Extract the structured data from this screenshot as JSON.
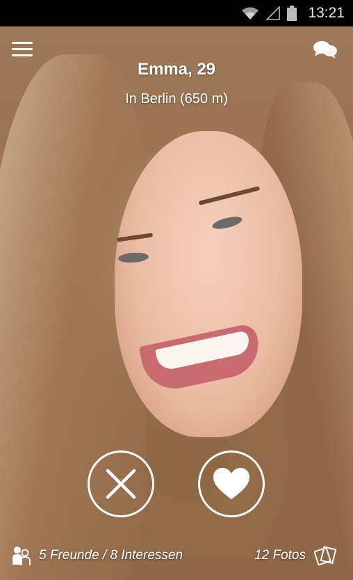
{
  "status_bar": {
    "time": "13:21",
    "icons": [
      "wifi-icon",
      "signal-icon",
      "battery-icon"
    ]
  },
  "header": {
    "menu_icon": "hamburger-menu-icon",
    "chat_icon": "chat-bubbles-icon"
  },
  "profile": {
    "name_age": "Emma, 29",
    "location": "In Berlin (650 m)"
  },
  "actions": {
    "dislike_icon": "close-x-icon",
    "like_icon": "heart-icon"
  },
  "footer": {
    "friends_interests": "5 Freunde / 8 Interessen",
    "photos_count": "12 Fotos",
    "friends_icon": "friends-icon",
    "photos_icon": "photos-icon"
  },
  "colors": {
    "accent": "#ffffff",
    "status_bar_bg": "#000000"
  }
}
